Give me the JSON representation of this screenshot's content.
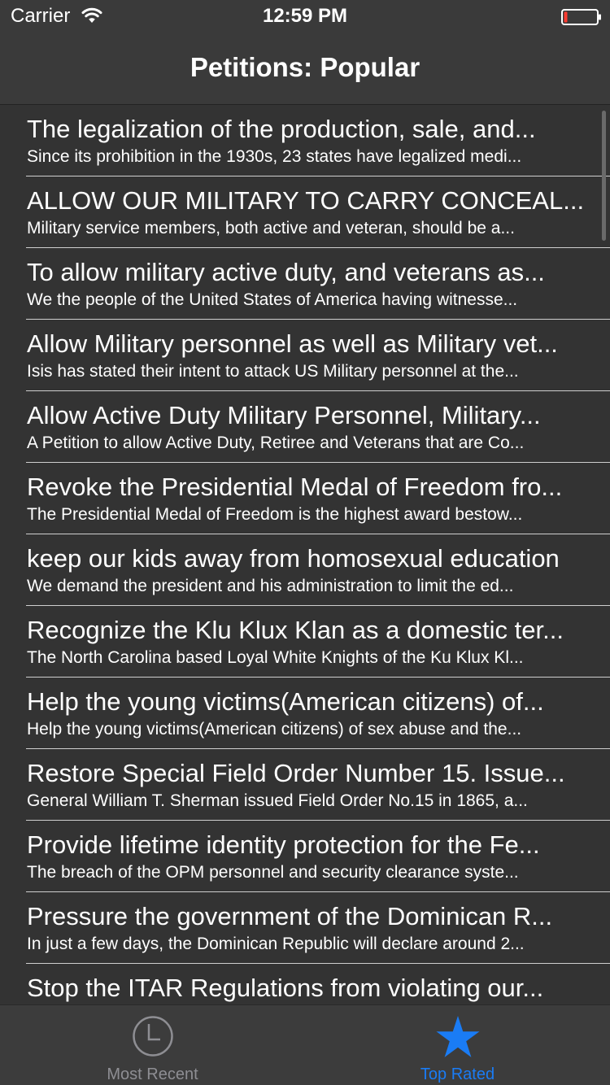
{
  "status_bar": {
    "carrier": "Carrier",
    "time": "12:59 PM",
    "icons": [
      "wifi-icon",
      "battery-icon"
    ]
  },
  "nav": {
    "title": "Petitions: Popular"
  },
  "petitions": [
    {
      "title": "The legalization of the production, sale, and...",
      "summary": "Since its prohibition in the 1930s, 23 states have legalized medi..."
    },
    {
      "title": "ALLOW OUR MILITARY TO CARRY CONCEAL...",
      "summary": "Military service members, both active and veteran, should be a..."
    },
    {
      "title": "To allow military active duty, and veterans as...",
      "summary": "We the people of the United States of America having witnesse..."
    },
    {
      "title": "Allow Military personnel as well as Military vet...",
      "summary": "Isis has stated their intent to attack US Military personnel at the..."
    },
    {
      "title": "Allow Active Duty Military Personnel, Military...",
      "summary": "A Petition to allow Active Duty, Retiree and Veterans that are Co..."
    },
    {
      "title": "Revoke the Presidential Medal of Freedom fro...",
      "summary": "The Presidential Medal of Freedom is the highest award bestow..."
    },
    {
      "title": "keep our kids away from homosexual education",
      "summary": "We demand the president and his administration  to limit the ed..."
    },
    {
      "title": "Recognize the Klu Klux Klan as a domestic ter...",
      "summary": "The North Carolina based Loyal White Knights of the Ku Klux Kl..."
    },
    {
      "title": "Help the young victims(American citizens) of...",
      "summary": "Help the young victims(American citizens) of sex abuse and the..."
    },
    {
      "title": "Restore Special Field Order Number 15. Issue...",
      "summary": "General William T. Sherman issued Field Order No.15 in 1865, a..."
    },
    {
      "title": "Provide lifetime identity protection for the Fe...",
      "summary": "The breach of the OPM personnel and security clearance syste..."
    },
    {
      "title": "Pressure the government of the Dominican R...",
      "summary": "In just a few days, the Dominican Republic will declare around 2..."
    },
    {
      "title": "Stop the ITAR Regulations from violating our...",
      "summary": ""
    }
  ],
  "tabs": [
    {
      "label": "Most Recent",
      "icon": "clock-icon",
      "selected": false,
      "color": "#8e8e93"
    },
    {
      "label": "Top Rated",
      "icon": "star-icon",
      "selected": true,
      "color": "#1a7cf5"
    }
  ],
  "colors": {
    "background": "#333333",
    "bar_background": "#3a3a3a",
    "accent": "#1a7cf5",
    "inactive": "#8e8e93",
    "separator": "#cfcfcf"
  }
}
